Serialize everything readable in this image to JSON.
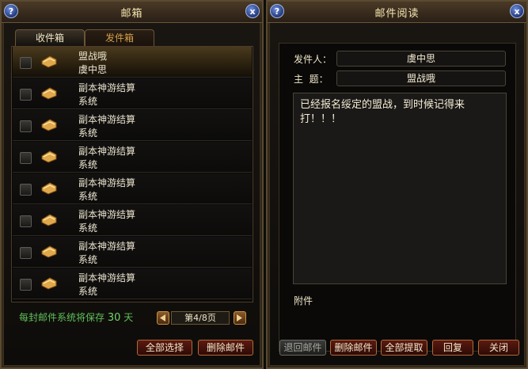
{
  "inbox": {
    "title": "邮箱",
    "help_icon": "?",
    "close_icon": "x",
    "tabs": [
      {
        "label": "收件箱",
        "active": true
      },
      {
        "label": "发件箱",
        "active": false
      }
    ],
    "mails": [
      {
        "subject": "盟战哦",
        "sender": "虞中思",
        "selected": true,
        "icon": "letter-icon"
      },
      {
        "subject": "副本神游结算",
        "sender": "系统",
        "selected": false,
        "icon": "letter-icon"
      },
      {
        "subject": "副本神游结算",
        "sender": "系统",
        "selected": false,
        "icon": "letter-icon"
      },
      {
        "subject": "副本神游结算",
        "sender": "系统",
        "selected": false,
        "icon": "letter-icon"
      },
      {
        "subject": "副本神游结算",
        "sender": "系统",
        "selected": false,
        "icon": "letter-icon"
      },
      {
        "subject": "副本神游结算",
        "sender": "系统",
        "selected": false,
        "icon": "letter-icon"
      },
      {
        "subject": "副本神游结算",
        "sender": "系统",
        "selected": false,
        "icon": "letter-icon"
      },
      {
        "subject": "副本神游结算",
        "sender": "系统",
        "selected": false,
        "icon": "letter-icon"
      }
    ],
    "retention_prefix": "每封邮件系统将保存",
    "retention_days": "30",
    "retention_suffix": "天",
    "page_indicator": "第4/8页",
    "select_all_label": "全部选择",
    "delete_label": "删除邮件"
  },
  "reader": {
    "title": "邮件阅读",
    "help_icon": "?",
    "close_icon": "x",
    "sender_label": "发件人：",
    "sender_value": "虞中思",
    "subject_label": "主  题：",
    "subject_value": "盟战哦",
    "body": "已经报名绥定的盟战，到时候记得来打！！！",
    "attachment_label": "附件",
    "buttons": {
      "return": "退回邮件",
      "delete": "删除邮件",
      "take_all": "全部提取",
      "reply": "回复",
      "close": "关闭"
    }
  },
  "colors": {
    "title_text": "#f4e6b0",
    "green_note": "#5fc05a",
    "button_red": "#5a1a10",
    "frame_gold": "#5a4a30"
  }
}
